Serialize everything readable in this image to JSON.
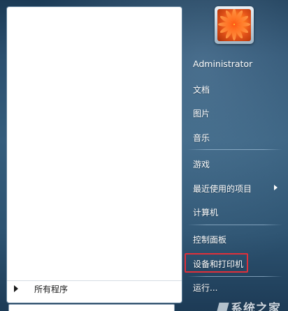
{
  "left_pane": {
    "all_programs_label": "所有程序"
  },
  "right_pane": {
    "user_name": "Administrator",
    "items": [
      {
        "label": "文档"
      },
      {
        "label": "图片"
      },
      {
        "label": "音乐"
      },
      {
        "label": "游戏"
      },
      {
        "label": "最近使用的项目"
      },
      {
        "label": "计算机"
      },
      {
        "label": "控制面板"
      },
      {
        "label": "设备和打印机"
      },
      {
        "label": "运行..."
      }
    ]
  },
  "watermark": {
    "text": "系统之家"
  },
  "colors": {
    "highlight_box": "#e0303a",
    "menu_background": "#2b4f6e"
  },
  "icons": {
    "submenu": "chevron-right-icon",
    "all_programs": "triangle-right-icon"
  }
}
